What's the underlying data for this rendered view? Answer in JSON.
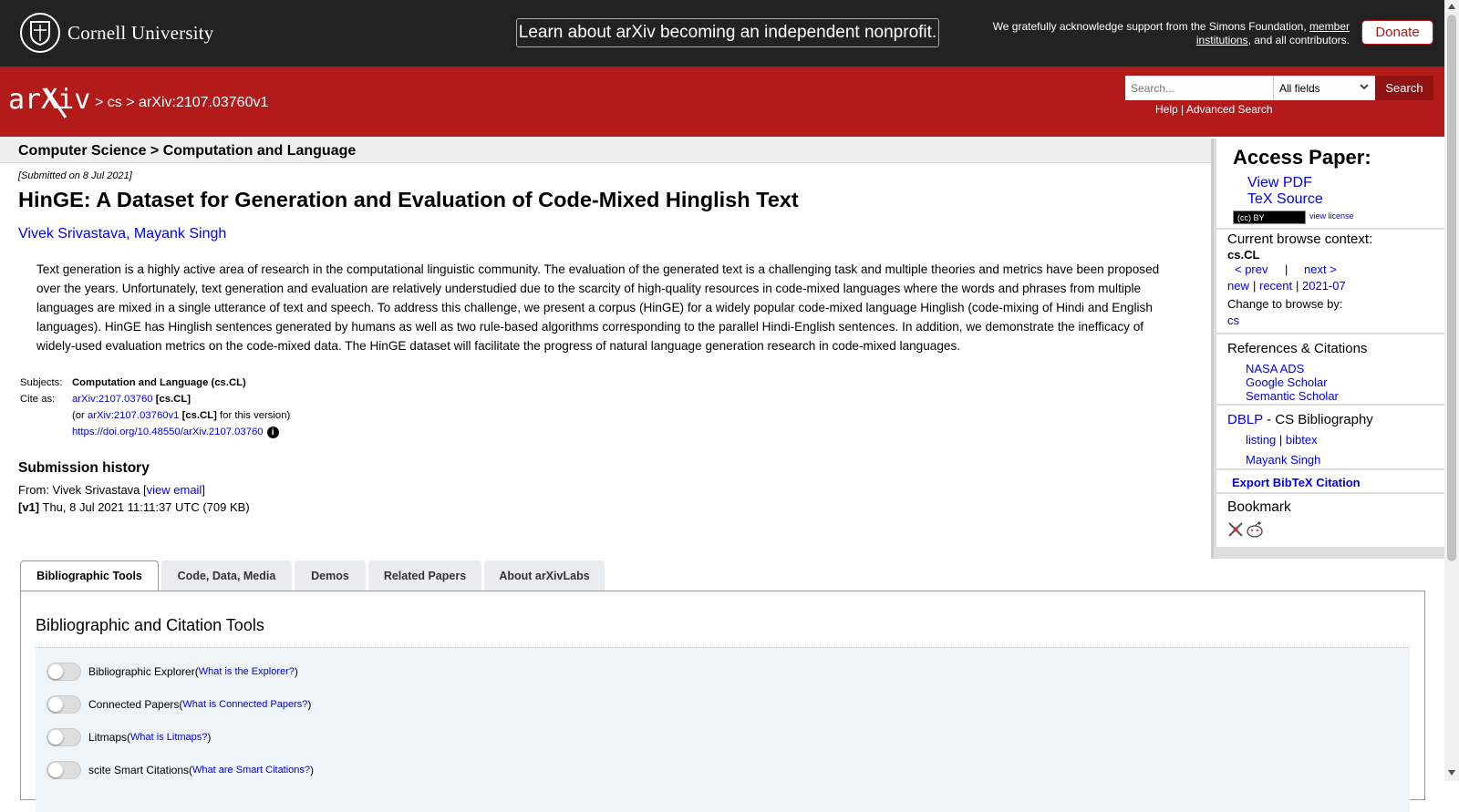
{
  "banner": {
    "cornell_name": "Cornell University",
    "nonprofit_text": "Learn about arXiv becoming an independent nonprofit.",
    "support_prefix": "We gratefully acknowledge support from the Simons Foundation, ",
    "support_link": "member institutions",
    "support_suffix": ", and all contributors.",
    "donate": "Donate"
  },
  "header": {
    "logo_text": "arXiv",
    "breadcrumb": [
      ">",
      "cs",
      ">",
      "arXiv:2107.03760v1"
    ],
    "search_placeholder": "Search...",
    "field_select": "All fields",
    "search_button": "Search",
    "help": "Help",
    "separator": "|",
    "advanced_search": "Advanced Search"
  },
  "subject_bar": "Computer Science > Computation and Language",
  "paper": {
    "submitted": "[Submitted on 8 Jul 2021]",
    "title": "HinGE: A Dataset for Generation and Evaluation of Code-Mixed Hinglish Text",
    "authors": [
      "Vivek Srivastava",
      "Mayank Singh"
    ],
    "author_sep": ", ",
    "abstract": "Text generation is a highly active area of research in the computational linguistic community. The evaluation of the generated text is a challenging task and multiple theories and metrics have been proposed over the years. Unfortunately, text generation and evaluation are relatively understudied due to the scarcity of high-quality resources in code-mixed languages where the words and phrases from multiple languages are mixed in a single utterance of text and speech. To address this challenge, we present a corpus (HinGE) for a widely popular code-mixed language Hinglish (code-mixing of Hindi and English languages). HinGE has Hinglish sentences generated by humans as well as two rule-based algorithms corresponding to the parallel Hindi-English sentences. In addition, we demonstrate the inefficacy of widely-used evaluation metrics on the code-mixed data. The HinGE dataset will facilitate the progress of natural language generation research in code-mixed languages.",
    "subjects_label": "Subjects:",
    "subjects_value": "Computation and Language (cs.CL)",
    "cite_label": "Cite as:",
    "cite_id": "arXiv:2107.03760",
    "cite_cat": "[cs.CL]",
    "cite_or": "(or ",
    "cite_version_id": "arXiv:2107.03760v1",
    "cite_version_cat": "[cs.CL]",
    "cite_version_suffix": " for this version)",
    "doi": "https://doi.org/10.48550/arXiv.2107.03760",
    "info_glyph": "i"
  },
  "history": {
    "heading": "Submission history",
    "from_prefix": "From: Vivek Srivastava [",
    "view_email": "view email",
    "from_suffix": "]",
    "v1_label": "[v1]",
    "v1_text": " Thu, 8 Jul 2021 11:11:37 UTC (709 KB)"
  },
  "sidebar": {
    "access_heading": "Access Paper:",
    "view_pdf": "View PDF",
    "tex_source": "TeX Source",
    "cc_badge": "(cc) BY",
    "view_license": "view license",
    "browse_heading": "Current browse context:",
    "browse_context": "cs.CL",
    "prev": "< prev",
    "pipe": "|",
    "next": "next >",
    "new": "new",
    "recent": "recent",
    "month": "2021-07",
    "change_browse": "Change to browse by:",
    "browse_cs": "cs",
    "refs_heading": "References & Citations",
    "nasa_ads": "NASA ADS",
    "google_scholar": "Google Scholar",
    "semantic_scholar": "Semantic Scholar",
    "dblp": "DBLP",
    "dblp_suffix": " - CS Bibliography",
    "listing": "listing",
    "bibtex": "bibtex",
    "dblp_author": "Mayank Singh",
    "export_bibtex": "Export BibTeX Citation",
    "bookmark_heading": "Bookmark"
  },
  "tabs": [
    "Bibliographic Tools",
    "Code, Data, Media",
    "Demos",
    "Related Papers",
    "About arXivLabs"
  ],
  "tools": {
    "heading": "Bibliographic and Citation Tools",
    "items": [
      {
        "label": "Bibliographic Explorer",
        "link": "What is the Explorer?"
      },
      {
        "label": "Connected Papers",
        "link": "What is Connected Papers?"
      },
      {
        "label": "Litmaps",
        "link": "What is Litmaps?"
      },
      {
        "label": "scite Smart Citations",
        "link": "What are Smart Citations?"
      }
    ],
    "open_paren": " (",
    "close_paren": ")"
  },
  "colors": {
    "arxiv_red": "#b31b1b",
    "banner_dark": "#222222",
    "link_blue": "#0000ee"
  },
  "icons": [
    "cornell-seal-icon",
    "arxiv-logo-icon",
    "chevron-down-icon",
    "info-icon",
    "bibsonomy-icon",
    "reddit-icon"
  ]
}
